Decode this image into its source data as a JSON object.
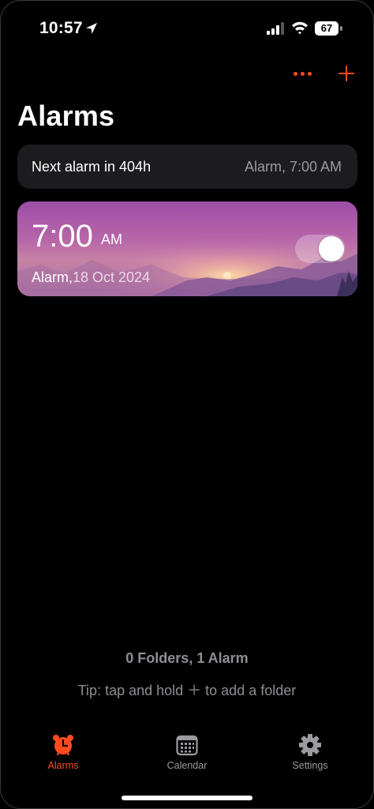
{
  "status_bar": {
    "time": "10:57",
    "battery": "67",
    "icons": [
      "location-arrow-icon",
      "cellular-signal-icon",
      "wifi-icon",
      "battery-icon"
    ]
  },
  "header": {
    "title": "Alarms",
    "more_icon": "ellipsis-icon",
    "add_icon": "plus-icon",
    "accent_color": "#ff4b1f"
  },
  "next_alarm": {
    "text": "Next alarm in 404h",
    "detail": "Alarm, 7:00 AM"
  },
  "alarm": {
    "time": "7:00",
    "ampm": "AM",
    "label": "Alarm,",
    "date": "18 Oct 2024",
    "enabled": true
  },
  "summary": {
    "count_text": "0 Folders, 1 Alarm",
    "tip": "Tip: tap and hold ＋ to add a folder"
  },
  "tab_bar": {
    "active": "Alarms",
    "tabs": [
      {
        "label": "Alarms",
        "icon": "alarm-clock-icon"
      },
      {
        "label": "Calendar",
        "icon": "calendar-icon"
      },
      {
        "label": "Settings",
        "icon": "gear-icon"
      }
    ]
  }
}
